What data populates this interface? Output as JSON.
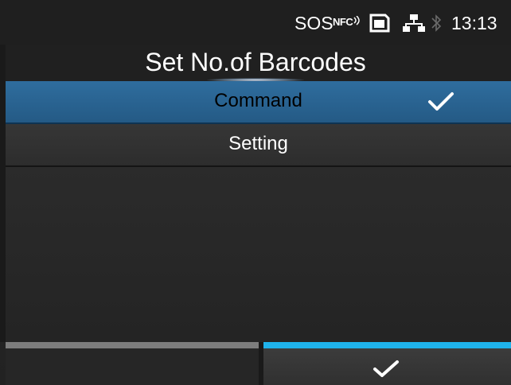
{
  "status_bar": {
    "sos_label": "SOS",
    "nfc_label": "NFC",
    "time": "13:13",
    "icons": [
      "nfc-icon",
      "sd-card-icon",
      "lan-icon",
      "bluetooth-icon"
    ]
  },
  "header": {
    "title": "Set No.of Barcodes"
  },
  "list": {
    "items": [
      {
        "label": "Command",
        "selected": true,
        "icon": "check-icon"
      },
      {
        "label": "Setting",
        "selected": false
      }
    ]
  },
  "softkeys": {
    "left": {
      "label": ""
    },
    "right": {
      "icon": "check-icon"
    }
  },
  "colors": {
    "selected_row": "#2a6496",
    "softkey_active": "#1fb3ec",
    "softkey_inactive": "#7d7d7d",
    "background": "#2a2a2a"
  }
}
